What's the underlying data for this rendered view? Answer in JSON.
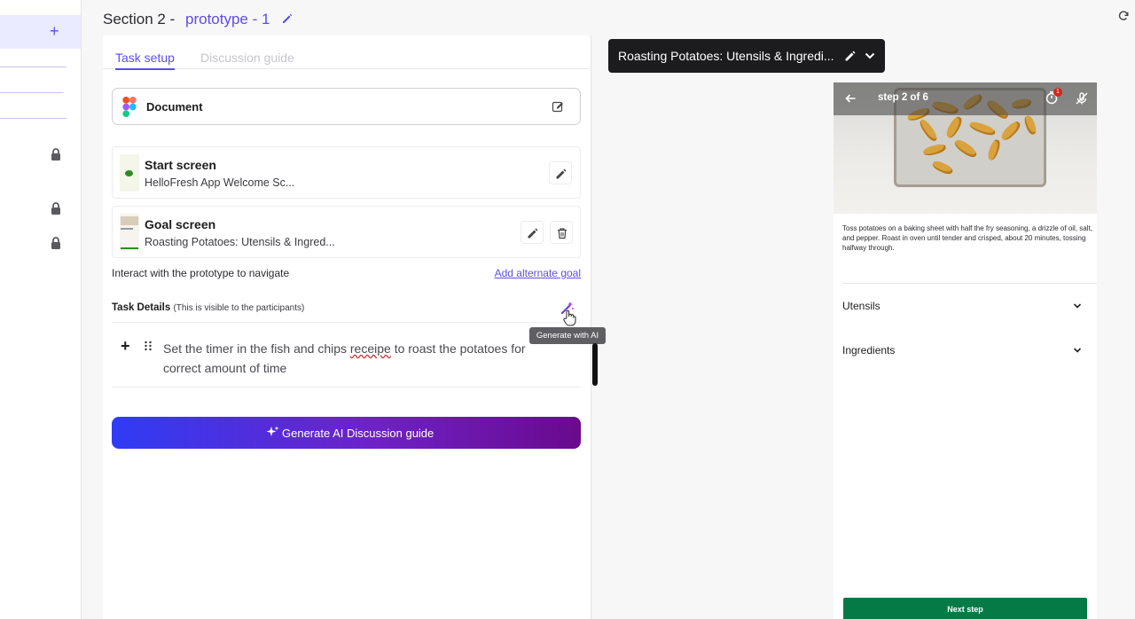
{
  "header": {
    "section_label": "Section 2 -",
    "prototype_name": "prototype - 1"
  },
  "tabs": [
    {
      "label": "Task setup",
      "active": true
    },
    {
      "label": "Discussion guide",
      "active": false
    }
  ],
  "document": {
    "label": "Document"
  },
  "start_screen": {
    "title": "Start screen",
    "subtitle": "HelloFresh App Welcome Sc..."
  },
  "goal_screen": {
    "title": "Goal screen",
    "subtitle": "Roasting Potatoes: Utensils & Ingred..."
  },
  "interact_hint": "Interact with the prototype to navigate",
  "add_alternate_goal": "Add alternate goal",
  "task_details": {
    "heading": "Task Details",
    "note": "(This is visible to the participants)",
    "tooltip": "Generate with AI",
    "text_before": "Set the timer in the fish and chips ",
    "text_misspelled": "receipe",
    "text_after": " to roast the potatoes for correct amount of time"
  },
  "generate_button": "Generate AI Discussion guide",
  "prototype_chip": {
    "title": "Roasting Potatoes: Utensils & Ingredi..."
  },
  "phone": {
    "step_label": "step 2 of 6",
    "timer_badge": "1",
    "instruction": "Toss potatoes on a baking sheet with half the fry seasoning, a drizzle of oil, salt, and pepper. Roast in oven until tender and crisped, about 20 minutes, tossing halfway through.",
    "accordions": [
      {
        "label": "Utensils"
      },
      {
        "label": "Ingredients"
      }
    ],
    "next_button": "Next step"
  },
  "colors": {
    "accent": "#5b4ee8",
    "next_button": "#067a46",
    "chip_bg": "#1c1c1e",
    "gradient_start": "#2f3cf5",
    "gradient_end": "#6a0a8d"
  },
  "icons": [
    "plus-icon",
    "lock-icon",
    "pencil-icon",
    "refresh-icon",
    "figma-icon",
    "edit-square-icon",
    "trash-icon",
    "magic-wand-icon",
    "drag-handle-icon",
    "sparkle-icon",
    "chevron-down-icon",
    "arrow-left-icon",
    "timer-icon",
    "mute-icon"
  ]
}
